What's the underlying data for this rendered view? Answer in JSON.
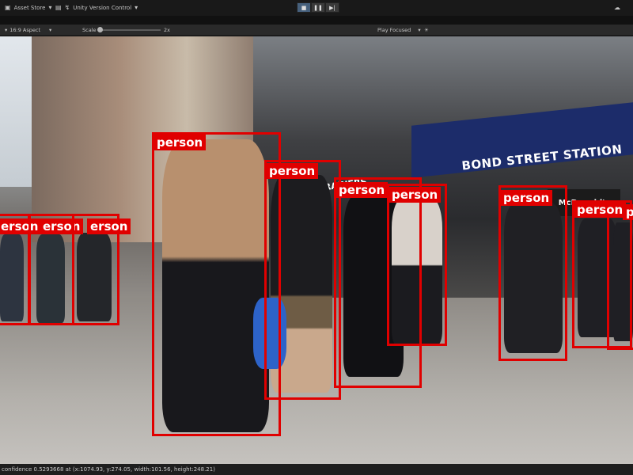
{
  "toolbar": {
    "asset_store": "Asset Store",
    "version_control": "Unity Version Control"
  },
  "gameview": {
    "aspect": "16:9 Aspect",
    "scale_label": "Scale",
    "scale_value": "2x",
    "play_focused": "Play Focused"
  },
  "colors": {
    "bbox": "#e00000",
    "label_text": "#ffffff"
  },
  "scene": {
    "station_sign": "BOND STREET STATION",
    "shop_sign": "KING OF TRAINERS",
    "mcd_sign": "McDonald's"
  },
  "detections": [
    {
      "label": "erson"
    },
    {
      "label": "erson"
    },
    {
      "label": "erson"
    },
    {
      "label": "person"
    },
    {
      "label": "person"
    },
    {
      "label": "person"
    },
    {
      "label": "person"
    },
    {
      "label": "person"
    },
    {
      "label": "person"
    },
    {
      "label": "p"
    }
  ],
  "status": {
    "text": "confidence 0.5293668 at (x:1074.93, y:274.05, width:101.56, height:248.21)"
  }
}
